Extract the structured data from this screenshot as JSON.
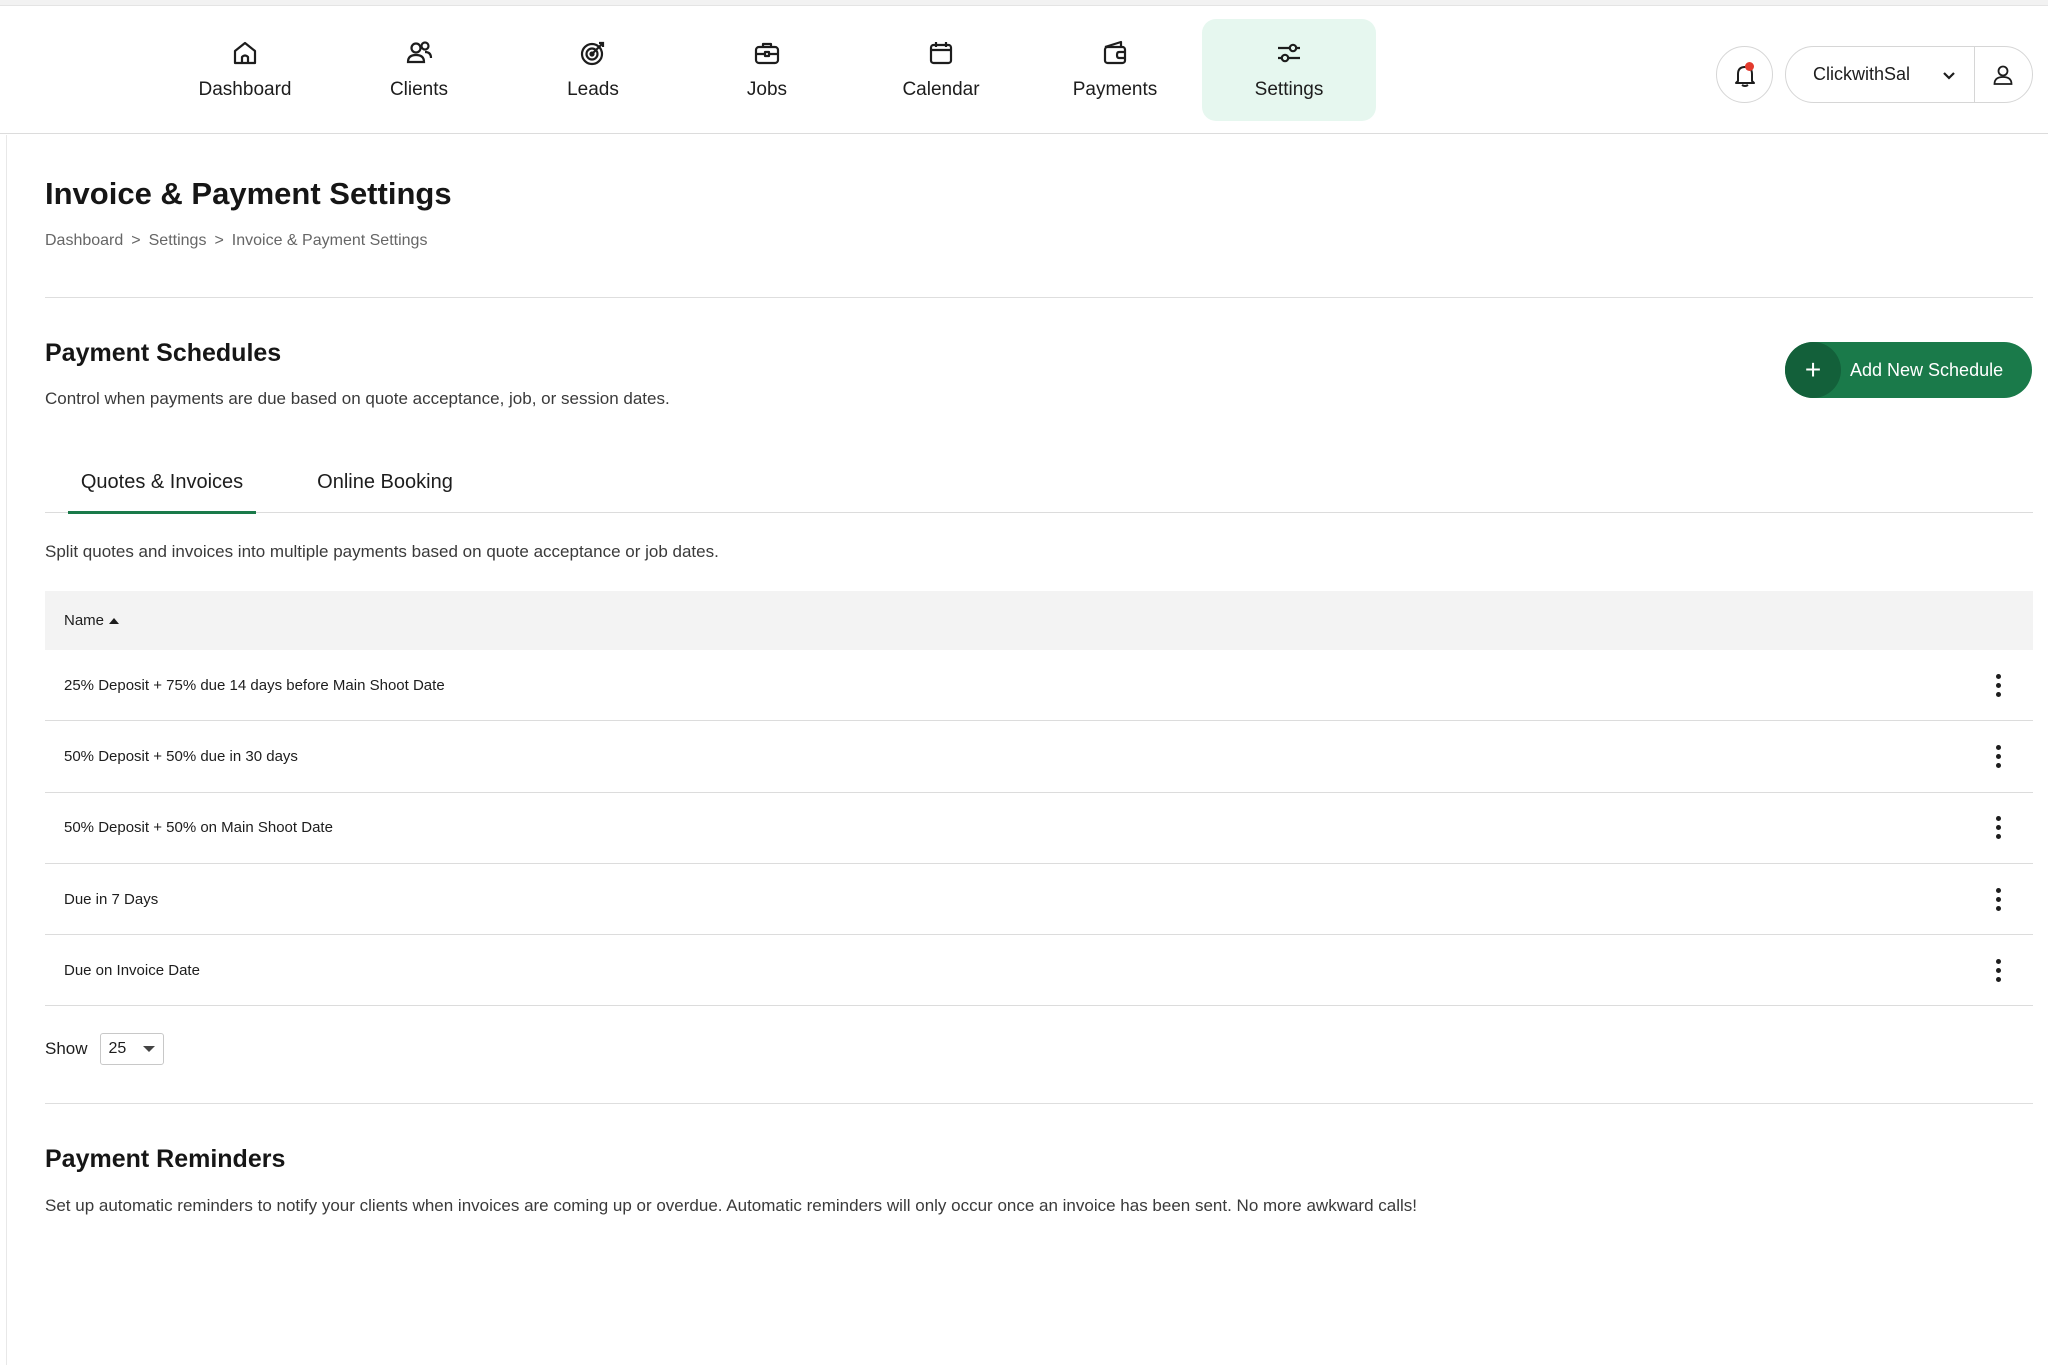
{
  "nav": {
    "items": [
      {
        "label": "Dashboard",
        "icon": "home-icon"
      },
      {
        "label": "Clients",
        "icon": "users-icon"
      },
      {
        "label": "Leads",
        "icon": "target-icon"
      },
      {
        "label": "Jobs",
        "icon": "briefcase-icon"
      },
      {
        "label": "Calendar",
        "icon": "calendar-icon"
      },
      {
        "label": "Payments",
        "icon": "wallet-icon"
      },
      {
        "label": "Settings",
        "icon": "sliders-icon",
        "active": true
      }
    ],
    "account_name": "ClickwithSal",
    "active_color": "#e6f7ef",
    "notification_dot_color": "#e33b2e"
  },
  "page": {
    "title": "Invoice & Payment Settings",
    "breadcrumb": [
      "Dashboard",
      "Settings",
      "Invoice & Payment Settings"
    ],
    "breadcrumb_separator": ">"
  },
  "schedules": {
    "title": "Payment Schedules",
    "description": "Control when payments are due based on quote acceptance, job, or session dates.",
    "add_button_label": "Add New Schedule",
    "add_button_color": "#1a7a4a",
    "tabs": [
      "Quotes & Invoices",
      "Online Booking"
    ],
    "active_tab": "Quotes & Invoices",
    "tab_description": "Split quotes and invoices into multiple payments based on quote acceptance or job dates.",
    "table": {
      "column": "Name",
      "rows": [
        "25% Deposit + 75% due 14 days before Main Shoot Date",
        "50% Deposit + 50% due in 30 days",
        "50% Deposit + 50% on Main Shoot Date",
        "Due in 7 Days",
        "Due on Invoice Date"
      ]
    },
    "show_label": "Show",
    "page_size": "25"
  },
  "reminders": {
    "title": "Payment Reminders",
    "description": "Set up automatic reminders to notify your clients when invoices are coming up or overdue. Automatic reminders will only occur once an invoice has been sent. No more awkward calls!"
  }
}
